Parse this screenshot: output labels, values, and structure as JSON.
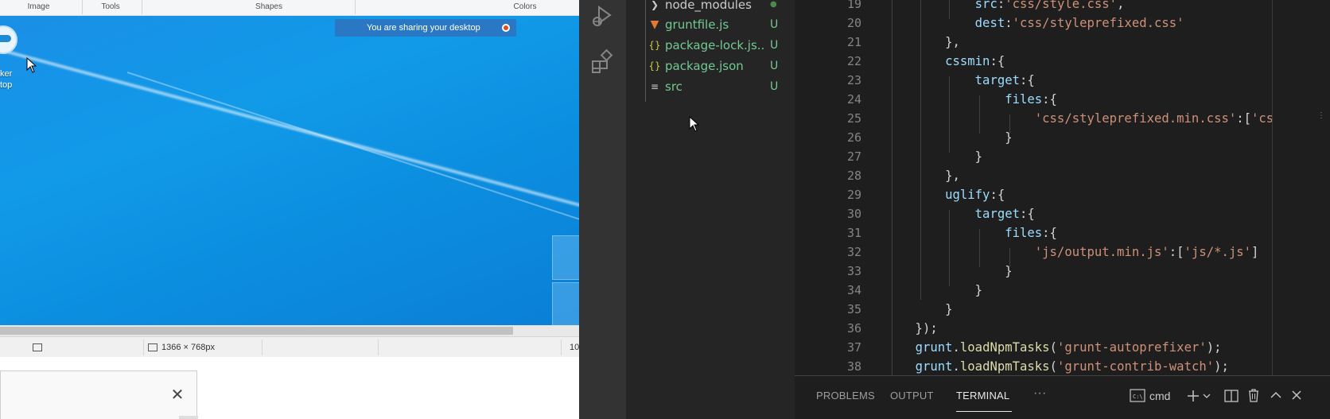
{
  "paint": {
    "ribbon": {
      "groups": [
        "Image",
        "Tools",
        "Shapes",
        "Colors"
      ]
    },
    "desktop_icon": {
      "label": "ker\ntop"
    },
    "sharing_banner": {
      "text": "You are sharing your desktop"
    },
    "statusbar": {
      "dimensions": "1366 × 768px",
      "zoom": "10"
    },
    "dialog": {
      "close_glyph": "✕"
    }
  },
  "vscode": {
    "explorer": {
      "items": [
        {
          "name": "node_modules",
          "status": "●",
          "icon": "folder-chevron-icon",
          "color": "#cccccc",
          "status_color": "#4b8a4b"
        },
        {
          "name": "gruntfile.js",
          "status": "U",
          "icon": "grunt-icon",
          "color": "#73c991",
          "status_color": "#73c991"
        },
        {
          "name": "package-lock.js...",
          "status": "U",
          "icon": "json-icon",
          "color": "#73c991",
          "status_color": "#73c991"
        },
        {
          "name": "package.json",
          "status": "U",
          "icon": "json-icon",
          "color": "#73c991",
          "status_color": "#73c991"
        },
        {
          "name": "src",
          "status": "U",
          "icon": "file-lines-icon",
          "color": "#73c991",
          "status_color": "#73c991"
        }
      ]
    },
    "editor": {
      "line_numbers": [
        "19",
        "20",
        "21",
        "22",
        "23",
        "24",
        "25",
        "26",
        "27",
        "28",
        "29",
        "30",
        "31",
        "32",
        "33",
        "34",
        "35",
        "36",
        "37",
        "38"
      ]
    },
    "panel": {
      "tabs": [
        "PROBLEMS",
        "OUTPUT",
        "TERMINAL"
      ],
      "active_tab": "TERMINAL",
      "more": "···",
      "terminal_name": "cmd"
    },
    "colors": {
      "background": "#1e1e1e",
      "sidebar": "#252526",
      "activity_bar": "#333333",
      "untracked": "#73c991",
      "string": "#ce9178",
      "property": "#9cdcfe",
      "function": "#dcdcaa"
    }
  }
}
